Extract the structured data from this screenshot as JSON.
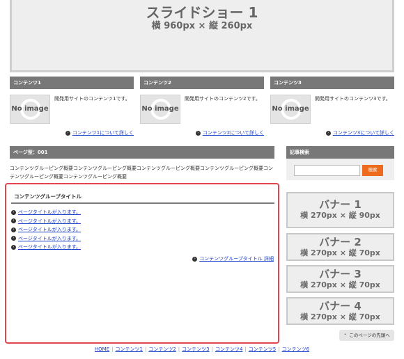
{
  "slideshow": {
    "title": "スライドショー 1",
    "size": "横 960px × 縦 260px"
  },
  "contents": [
    {
      "header": "コンテンツ1",
      "image_label": "No image",
      "description": "開発用サイトのコンテンツ1です。",
      "more": "コンテンツ1について詳しく"
    },
    {
      "header": "コンテンツ2",
      "image_label": "No image",
      "description": "開発用サイトのコンテンツ2です。",
      "more": "コンテンツ2について詳しく"
    },
    {
      "header": "コンテンツ3",
      "image_label": "No image",
      "description": "開発用サイトのコンテンツ3です。",
      "more": "コンテンツ3について詳しく"
    }
  ],
  "main": {
    "header": "ページ型：001",
    "overview": "コンテンツグルーピング概要コンテンツグルーピング概要コンテンツグルーピング概要コンテンツグルーピング概要コンテンツグルーピング概要コンテンツグルーピング概要",
    "group": {
      "title": "コンテンツグループタイトル",
      "items": [
        "ページタイトルが入ります。",
        "ページタイトルが入ります。",
        "ページタイトルが入ります。",
        "ページタイトルが入ります。",
        "ページタイトルが入ります。"
      ],
      "more": "コンテンツグループタイトル 詳細"
    }
  },
  "sidebar": {
    "search_header": "記事検索",
    "search_placeholder": "",
    "search_button": "検索",
    "banners": [
      {
        "title": "バナー 1",
        "size": "横 270px × 縦 90px"
      },
      {
        "title": "バナー 2",
        "size": "横 270px × 縦 70px"
      },
      {
        "title": "バナー 3",
        "size": "横 270px × 縦 70px"
      },
      {
        "title": "バナー 4",
        "size": "横 270px × 縦 70px"
      }
    ],
    "to_top": "このページの先頭へ"
  },
  "footer": {
    "links": [
      "HOME",
      "コンテンツ1",
      "コンテンツ2",
      "コンテンツ3",
      "コンテンツ4",
      "コンテンツ5",
      "コンテンツ6"
    ]
  },
  "colors": {
    "header_bg": "#787878",
    "accent": "#ee6a1c",
    "link": "#1a3fc9",
    "highlight_border": "#e3454f"
  }
}
